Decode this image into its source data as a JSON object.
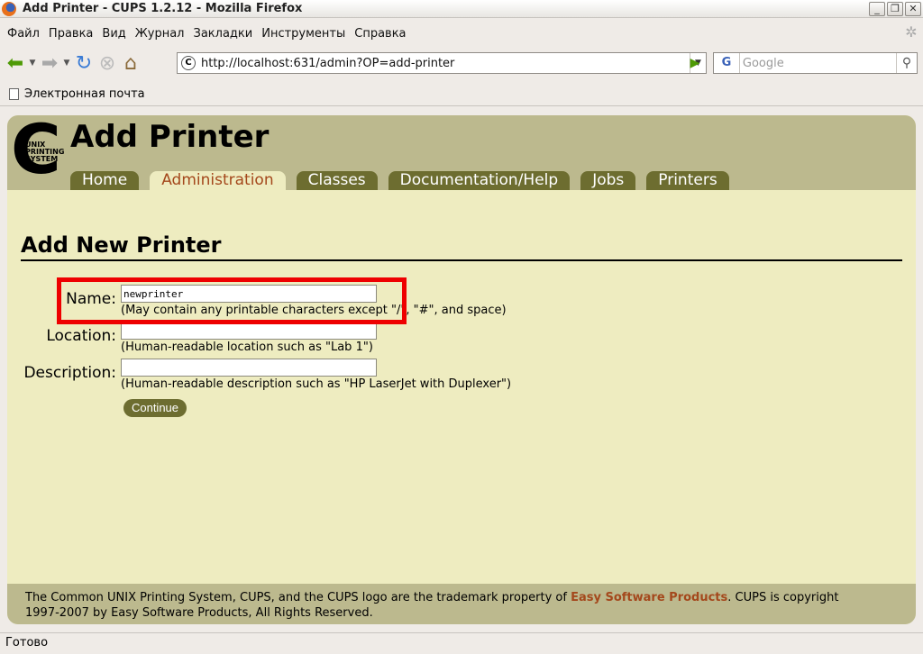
{
  "window": {
    "title": "Add Printer - CUPS 1.2.12 - Mozilla Firefox"
  },
  "menu": [
    "Файл",
    "Правка",
    "Вид",
    "Журнал",
    "Закладки",
    "Инструменты",
    "Справка"
  ],
  "nav": {
    "url": "http://localhost:631/admin?OP=add-printer",
    "search_placeholder": "Google",
    "search_engine": "G"
  },
  "bookmarks": [
    "Электронная почта"
  ],
  "cups": {
    "logo_letter": "C",
    "logo_text_1": "UNIX",
    "logo_text_2": "PRINTING",
    "logo_text_3": "SYSTEM",
    "header_title": "Add Printer",
    "tabs": [
      "Home",
      "Administration",
      "Classes",
      "Documentation/Help",
      "Jobs",
      "Printers"
    ],
    "active_tab": "Administration",
    "heading": "Add New Printer",
    "form": {
      "name_label": "Name:",
      "name_value": "newprinter",
      "name_hint": "(May contain any printable characters except \"/\", \"#\", and space)",
      "location_label": "Location:",
      "location_value": "",
      "location_hint": "(Human-readable location such as \"Lab 1\")",
      "description_label": "Description:",
      "description_value": "",
      "description_hint": "(Human-readable description such as \"HP LaserJet with Duplexer\")",
      "continue_label": "Continue"
    },
    "footer": {
      "text_before": "The Common UNIX Printing System, CUPS, and the CUPS logo are the trademark property of ",
      "link": "Easy Software Products",
      "text_after": ". CUPS is copyright",
      "line2": "1997-2007 by Easy Software Products, All Rights Reserved."
    }
  },
  "status": {
    "text": "Готово"
  },
  "colors": {
    "header": "#bcb98e",
    "content": "#eeecc0",
    "tab": "#6d6d30",
    "active_tab_text": "#a4481c",
    "highlight": "#ee0000"
  }
}
